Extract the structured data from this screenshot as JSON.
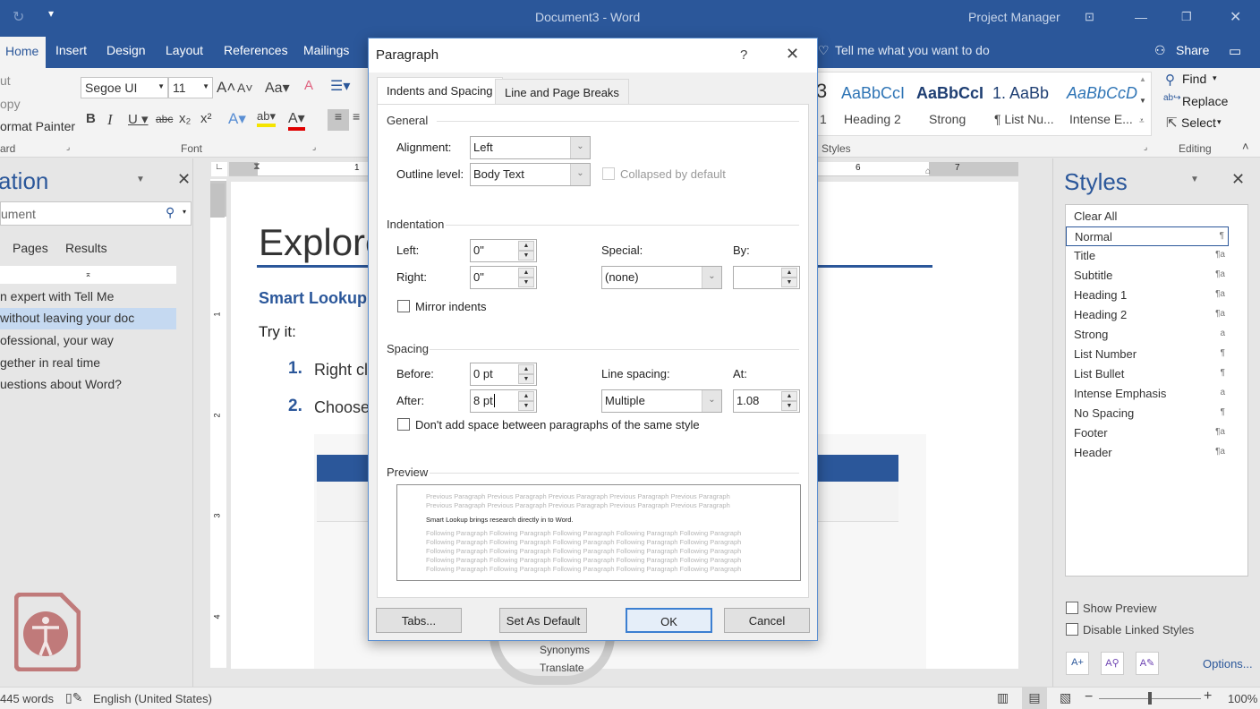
{
  "titlebar": {
    "doc_title": "Document3  -  Word",
    "user": "Project Manager"
  },
  "ribbon": {
    "tabs": [
      "Home",
      "Insert",
      "Design",
      "Layout",
      "References",
      "Mailings"
    ],
    "tell_me": "Tell me what you want to do",
    "share": "Share",
    "clipboard": {
      "cut": "ut",
      "copy": "opy",
      "format_painter": "ormat Painter",
      "label": "ard"
    },
    "font": {
      "name": "Segoe UI",
      "size": "11",
      "label": "Font"
    },
    "styles": {
      "label": "Styles",
      "gallery": [
        {
          "sample": "AaBbCcI",
          "name": "Heading 2"
        },
        {
          "sample": "AaBbCcI",
          "name": "Strong"
        },
        {
          "sample": "1.  AaBb",
          "name": "¶ List Nu..."
        },
        {
          "sample": "AaBbCcD",
          "name": "Intense E..."
        }
      ],
      "partial_name": "1"
    },
    "editing": {
      "find": "Find",
      "replace": "Replace",
      "select": "Select",
      "label": "Editing"
    }
  },
  "nav_pane": {
    "title": "ation",
    "search_value": "ument",
    "tabs": [
      "Pages",
      "Results"
    ],
    "headings": [
      "n expert with Tell Me",
      "without leaving your doc",
      "ofessional, your way",
      "gether in real time",
      "uestions about Word?"
    ],
    "selected_index": 1
  },
  "document": {
    "title": "Explore",
    "heading": "Smart Lookup",
    "body": "Try it:",
    "list": [
      {
        "num": "1.",
        "text": "Right cl"
      },
      {
        "num": "2.",
        "text": "Choose"
      }
    ],
    "ruler_marks": [
      "1",
      "6",
      "7"
    ],
    "vruler_marks": [
      "1",
      "2",
      "3",
      "4"
    ],
    "embedded_screenshot": {
      "synonyms": "Synonyms",
      "translate": "Translate"
    }
  },
  "dialog": {
    "title": "Paragraph",
    "help": "?",
    "tabs": [
      "Indents and Spacing",
      "Line and Page Breaks"
    ],
    "active_tab": 0,
    "general": {
      "label": "General",
      "alignment_label": "Alignment:",
      "alignment_value": "Left",
      "outline_label": "Outline level:",
      "outline_value": "Body Text",
      "collapsed_label": "Collapsed by default",
      "collapsed_checked": false
    },
    "indentation": {
      "label": "Indentation",
      "left_label": "Left:",
      "left_value": "0\"",
      "right_label": "Right:",
      "right_value": "0\"",
      "special_label": "Special:",
      "special_value": "(none)",
      "by_label": "By:",
      "by_value": "",
      "mirror_label": "Mirror indents",
      "mirror_checked": false
    },
    "spacing": {
      "label": "Spacing",
      "before_label": "Before:",
      "before_value": "0 pt",
      "after_label": "After:",
      "after_value": "8 pt",
      "line_spacing_label": "Line spacing:",
      "line_spacing_value": "Multiple",
      "at_label": "At:",
      "at_value": "1.08",
      "dont_add_label": "Don't add space between paragraphs of the same style",
      "dont_add_checked": false
    },
    "preview": {
      "label": "Preview",
      "previous": "Previous Paragraph Previous Paragraph Previous Paragraph Previous Paragraph Previous Paragraph Previous Paragraph Previous Paragraph Previous Paragraph Previous Paragraph Previous Paragraph",
      "current": "Smart Lookup brings research directly in to Word.",
      "following": "Following Paragraph Following Paragraph Following Paragraph Following Paragraph Following Paragraph Following Paragraph Following Paragraph Following Paragraph Following Paragraph Following Paragraph Following Paragraph Following Paragraph Following Paragraph Following Paragraph Following Paragraph Following Paragraph Following Paragraph Following Paragraph Following Paragraph Following Paragraph Following Paragraph Following Paragraph Following Paragraph Following Paragraph Following Paragraph"
    },
    "buttons": {
      "tabs": "Tabs...",
      "set_default": "Set As Default",
      "ok": "OK",
      "cancel": "Cancel"
    }
  },
  "styles_pane": {
    "title": "Styles",
    "items": [
      {
        "name": "Clear All",
        "mark": ""
      },
      {
        "name": "Normal",
        "mark": "¶"
      },
      {
        "name": "Title",
        "mark": "¶a"
      },
      {
        "name": "Subtitle",
        "mark": "¶a"
      },
      {
        "name": "Heading 1",
        "mark": "¶a"
      },
      {
        "name": "Heading 2",
        "mark": "¶a"
      },
      {
        "name": "Strong",
        "mark": "a"
      },
      {
        "name": "List Number",
        "mark": "¶"
      },
      {
        "name": "List Bullet",
        "mark": "¶"
      },
      {
        "name": "Intense Emphasis",
        "mark": "a"
      },
      {
        "name": "No Spacing",
        "mark": "¶"
      },
      {
        "name": "Footer",
        "mark": "¶a"
      },
      {
        "name": "Header",
        "mark": "¶a"
      }
    ],
    "selected": "Normal",
    "show_preview": "Show Preview",
    "disable_linked": "Disable Linked Styles",
    "options": "Options..."
  },
  "statusbar": {
    "words": "445 words",
    "language": "English (United States)",
    "zoom": "100%",
    "zoom_fraction": 0.5
  },
  "colors": {
    "brand": "#2b579a",
    "accent": "#3c7fd1",
    "accessibility_icon": "#c07a7a"
  }
}
